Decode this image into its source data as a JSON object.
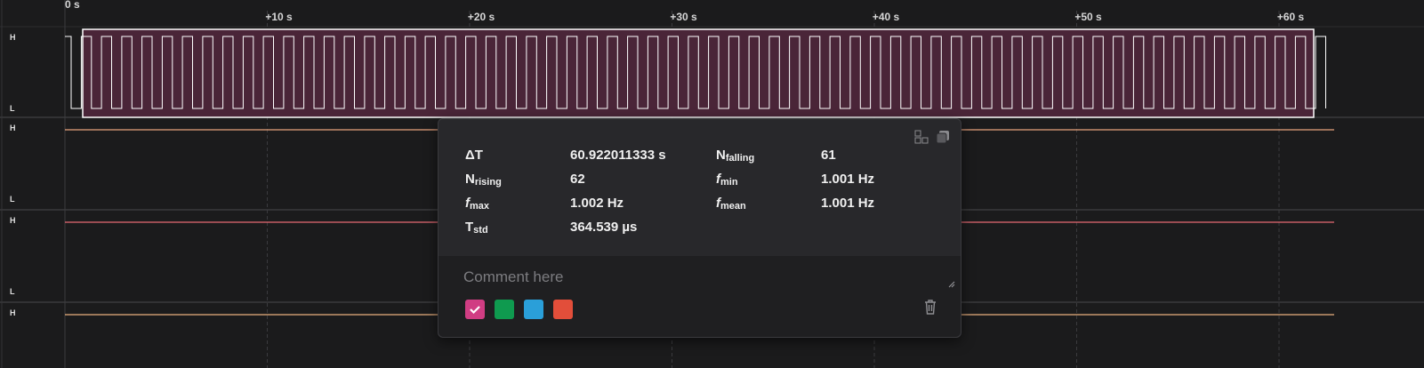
{
  "timeline": {
    "ticks": [
      "0 s",
      "+10 s",
      "+20 s",
      "+30 s",
      "+40 s",
      "+50 s",
      "+60 s"
    ]
  },
  "channels": [
    {
      "high_label": "H",
      "low_label": "L",
      "color": "#ffffff",
      "type": "square"
    },
    {
      "high_label": "H",
      "low_label": "L",
      "color": "#e8a27d",
      "type": "flat"
    },
    {
      "high_label": "H",
      "low_label": "L",
      "color": "#e56a73",
      "type": "flat"
    },
    {
      "high_label": "H",
      "low_label": "",
      "color": "#e9b07e",
      "type": "flat"
    }
  ],
  "selection": {
    "fill": "#4a2538",
    "border": "#ffffff"
  },
  "measurements": {
    "delta_t": {
      "label": "ΔT",
      "value": "60.922011333 s"
    },
    "n_falling": {
      "label": "N",
      "sub": "falling",
      "value": "61"
    },
    "n_rising": {
      "label": "N",
      "sub": "rising",
      "value": "62"
    },
    "f_min": {
      "label": "f",
      "sub": "min",
      "value": "1.001 Hz"
    },
    "f_max": {
      "label": "f",
      "sub": "max",
      "value": "1.002 Hz"
    },
    "f_mean": {
      "label": "f",
      "sub": "mean",
      "value": "1.001 Hz"
    },
    "t_std": {
      "label": "T",
      "sub": "std",
      "value": "364.539 µs"
    }
  },
  "comment": {
    "placeholder": "Comment here",
    "value": ""
  },
  "colors": {
    "swatches": [
      "#d03d83",
      "#0f9a4f",
      "#2a9fd9",
      "#e24e3a"
    ],
    "selected_index": 0
  }
}
